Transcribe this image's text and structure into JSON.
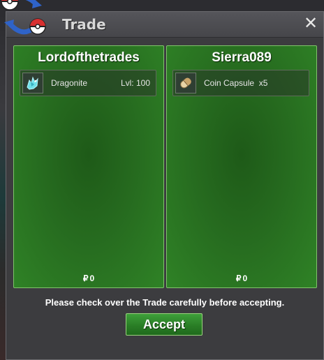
{
  "window": {
    "title": "Trade",
    "close_symbol": "✕",
    "logo_icon": "pokeball-swap-icon"
  },
  "colors": {
    "panel_green": "#266b1f",
    "panel_border": "#7fc46a",
    "window_bg": "#3c3c3f",
    "button_green": "#2a7e26"
  },
  "left_panel": {
    "trader": "Lordofthetrades",
    "items": [
      {
        "icon": "dragonite-icon",
        "name": "Dragonite",
        "level": "Lvl: 100"
      }
    ],
    "money_symbol": "₽",
    "money": "0"
  },
  "right_panel": {
    "trader": "Sierra089",
    "items": [
      {
        "icon": "coin-capsule-icon",
        "name": "Coin Capsule  x5"
      }
    ],
    "money_symbol": "₽",
    "money": "0"
  },
  "footer": {
    "notice": "Please check over the Trade carefully before accepting.",
    "accept_label": "Accept"
  }
}
